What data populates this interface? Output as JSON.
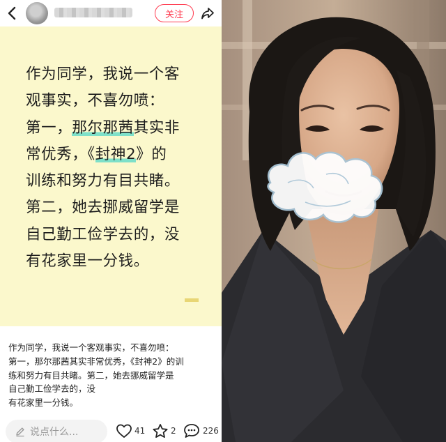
{
  "header": {
    "follow_label": "关注"
  },
  "card": {
    "lines": [
      {
        "parts": [
          {
            "text": "作为同学，我说一个客",
            "hl": false
          }
        ]
      },
      {
        "parts": [
          {
            "text": "观事实，不喜勿喷：",
            "hl": false
          }
        ]
      },
      {
        "parts": [
          {
            "text": "第一，",
            "hl": false
          },
          {
            "text": "那尔那茜",
            "hl": true
          },
          {
            "text": "其实非",
            "hl": false
          }
        ]
      },
      {
        "parts": [
          {
            "text": "常优秀，《",
            "hl": false
          },
          {
            "text": "封神2",
            "hl": true
          },
          {
            "text": "》的",
            "hl": false
          }
        ]
      },
      {
        "parts": [
          {
            "text": "训练和努力有目共睹。",
            "hl": false
          }
        ]
      },
      {
        "parts": [
          {
            "text": "第二，她去挪威留学是",
            "hl": false
          }
        ]
      },
      {
        "parts": [
          {
            "text": "自己勤工俭学去的，没",
            "hl": false
          }
        ]
      },
      {
        "parts": [
          {
            "text": "有花家里一分钱。",
            "hl": false
          }
        ]
      }
    ],
    "highlight_color": "#7ee0c9",
    "background": "#fbf8cc"
  },
  "caption": {
    "lines": [
      "作为同学，我说一个客观事实，不喜勿喷：",
      "第一，那尔那茜其实非常优秀，《封神2》的训",
      "练和努力有目共睹。第二，她去挪威留学是",
      "自己勤工俭学去的，没",
      "有花家里一分钱。"
    ]
  },
  "footer": {
    "comment_placeholder": "说点什么...",
    "likes": "41",
    "favorites": "2",
    "comments": "226"
  },
  "colors": {
    "accent": "#ff3b4f",
    "text": "#1d1d1d"
  },
  "icons": [
    "back-arrow-icon",
    "share-icon",
    "pencil-icon",
    "heart-icon",
    "star-icon",
    "comment-icon"
  ]
}
